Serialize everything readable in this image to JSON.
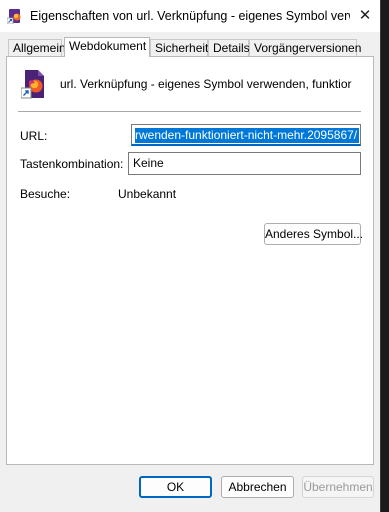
{
  "window": {
    "title": "Eigenschaften von url. Verknüpfung - eigenes Symbol verw...",
    "close_glyph": "✕"
  },
  "tabs": [
    {
      "label": "Allgemein"
    },
    {
      "label": "Webdokument"
    },
    {
      "label": "Sicherheit"
    },
    {
      "label": "Details"
    },
    {
      "label": "Vorgängerversionen"
    }
  ],
  "shortcut": {
    "name": "url. Verknüpfung - eigenes Symbol verwenden, funktior"
  },
  "fields": {
    "url_label": "URL:",
    "url_value": "rwenden-funktioniert-nicht-mehr.2095867/",
    "hotkey_label": "Tastenkombination:",
    "hotkey_value": "Keine",
    "visits_label": "Besuche:",
    "visits_value": "Unbekannt"
  },
  "buttons": {
    "change_icon": "Anderes Symbol...",
    "ok": "OK",
    "cancel": "Abbrechen",
    "apply": "Übernehmen"
  },
  "colors": {
    "accent": "#0067c0",
    "selection": "#0078d7"
  }
}
